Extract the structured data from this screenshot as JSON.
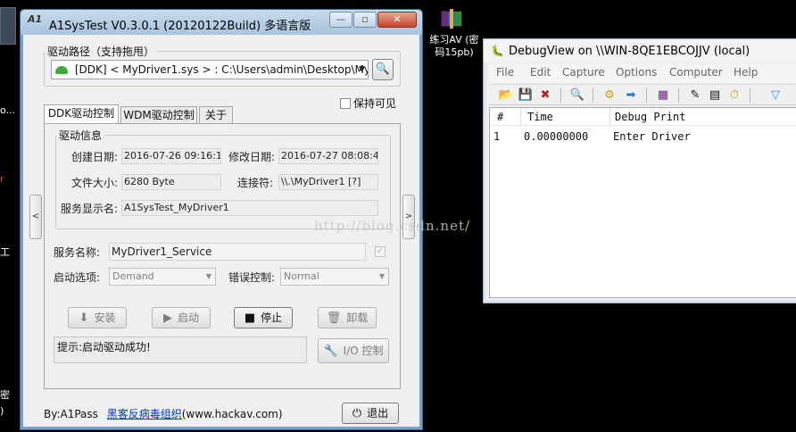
{
  "desktop": {
    "left_fragments": [
      "o...",
      "r",
      "工",
      "密",
      ")"
    ],
    "winrar_label_line1": "练习AV (密",
    "winrar_label_line2": "码15pb)"
  },
  "main_window": {
    "title": "A1SysTest V0.3.0.1  (20120122Build) 多语言版",
    "logo_text": "A1",
    "caption_min": "—",
    "caption_max": "▫",
    "caption_close": "✕",
    "path_group_label": "驱动路径（支持拖甩）",
    "path_value": "[DDK] < MyDriver1.sys > :  C:\\Users\\admin\\Desktop\\MyD",
    "tabs": [
      {
        "label": "DDK驱动控制",
        "active": true
      },
      {
        "label": "WDM驱动控制",
        "active": false
      },
      {
        "label": "关于",
        "active": false
      }
    ],
    "keep_visible_label": "保持可见",
    "driver_info_label": "驱动信息",
    "created_label": "创建日期:",
    "created_value": "2016-07-26 09:16:12",
    "modified_label": "修改日期:",
    "modified_value": "2016-07-27 08:08:40",
    "size_label": "文件大小:",
    "size_value": "6280  Byte",
    "link_label": "连接符:",
    "link_value": "\\\\.\\MyDriver1  [?]",
    "display_name_label": "服务显示名:",
    "display_name_value": "A1SysTest_MyDriver1",
    "service_name_label": "服务名称:",
    "service_name_value": "MyDriver1_Service",
    "start_option_label": "启动选项:",
    "start_option_value": "Demand",
    "error_control_label": "错误控制:",
    "error_control_value": "Normal",
    "buttons": {
      "install": "安装",
      "start": "启动",
      "stop": "停止",
      "uninstall": "卸载",
      "io_control": "I/O 控制",
      "exit": "退出"
    },
    "status_text": "提示:启动驱动成功!",
    "footer_by": "By:A1Pass",
    "footer_link": "黑客反病毒组织",
    "footer_url": "(www.hackav.com)",
    "nav_left": "<",
    "nav_right": ">"
  },
  "debugview": {
    "title": "DebugView on \\\\WIN-8QE1EBCOJJV (local)",
    "menu": [
      "File",
      "Edit",
      "Capture",
      "Options",
      "Computer",
      "Help"
    ],
    "columns": [
      "#",
      "Time",
      "Debug Print"
    ],
    "rows": [
      {
        "num": "1",
        "time": "0.00000000",
        "text": "Enter Driver"
      }
    ]
  },
  "watermark": "http://blog.csdn.net/"
}
